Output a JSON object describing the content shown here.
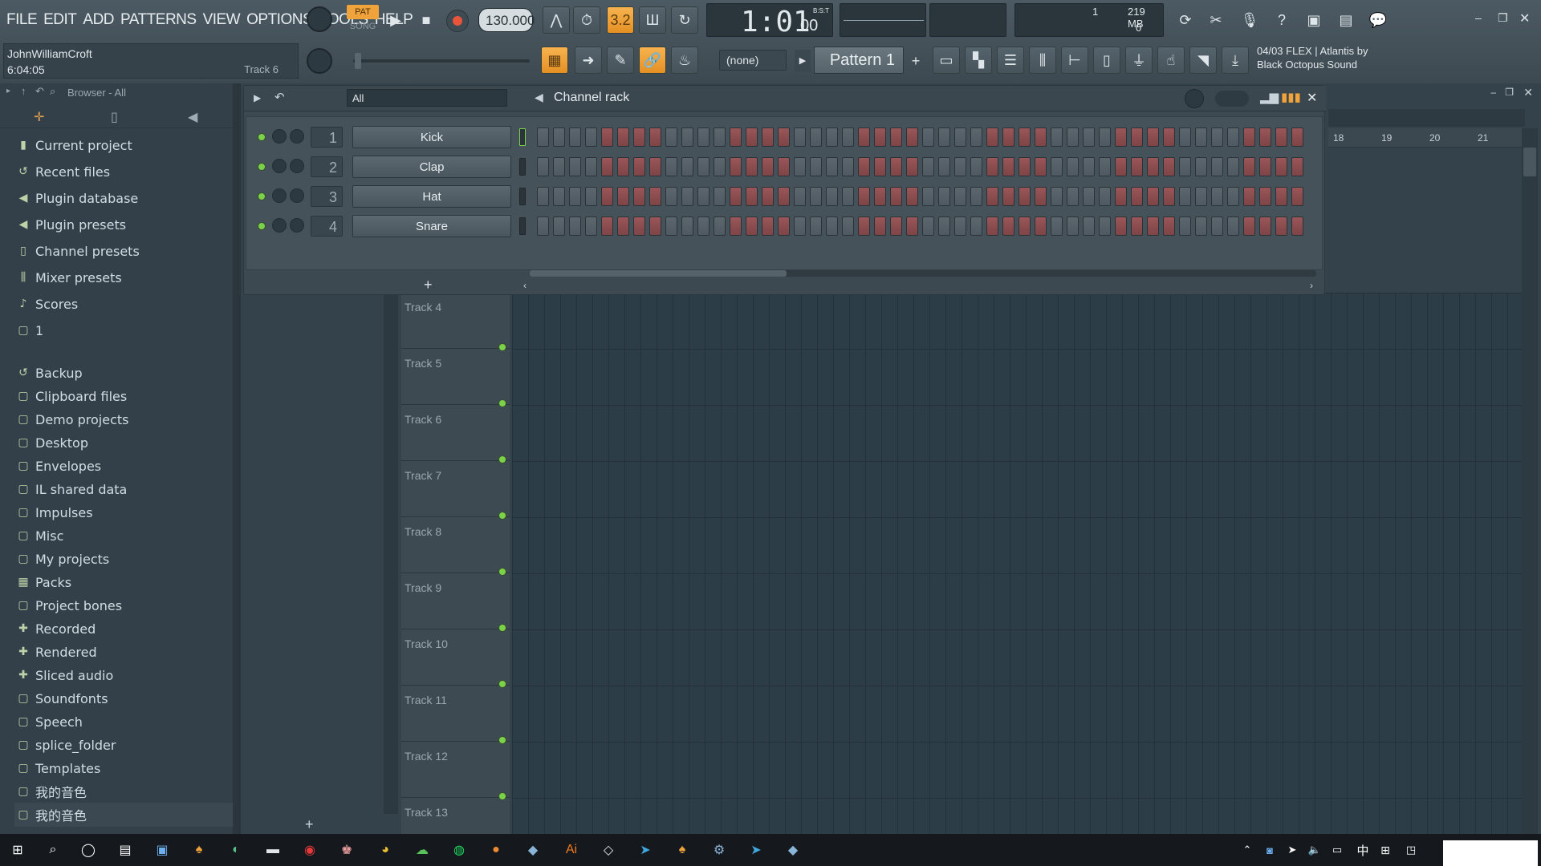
{
  "menu": [
    "FILE",
    "EDIT",
    "ADD",
    "PATTERNS",
    "VIEW",
    "OPTIONS",
    "TOOLS",
    "HELP"
  ],
  "transport": {
    "pat": "PAT",
    "song": "SONG",
    "tempo": "130.000",
    "time": "1:01",
    "time_small": "00",
    "bst": "B:S:T"
  },
  "monitor": {
    "cpu": "1",
    "mem": "219 MB",
    "poly": "0"
  },
  "hint": {
    "user": "JohnWilliamCroft",
    "time": "6:04:05",
    "track": "Track 6"
  },
  "pattern": {
    "none_label": "(none)",
    "name": "Pattern 1"
  },
  "news": {
    "line1": "04/03  FLEX | Atlantis by",
    "line2": "Black Octopus Sound"
  },
  "browser": {
    "header": "Browser - All",
    "items": [
      {
        "label": "Current project",
        "icon": "project-icon"
      },
      {
        "label": "Recent files",
        "icon": "recent-icon"
      },
      {
        "label": "Plugin database",
        "icon": "plugin-icon"
      },
      {
        "label": "Plugin presets",
        "icon": "preset-icon"
      },
      {
        "label": "Channel presets",
        "icon": "channel-icon"
      },
      {
        "label": "Mixer presets",
        "icon": "mixer-icon"
      },
      {
        "label": "Scores",
        "icon": "note-icon"
      },
      {
        "label": "1",
        "icon": "folder-icon"
      },
      {
        "label": "Backup",
        "icon": "recent-icon"
      },
      {
        "label": "Clipboard files",
        "icon": "folder-icon"
      },
      {
        "label": "Demo projects",
        "icon": "folder-icon"
      },
      {
        "label": "Desktop",
        "icon": "folder-icon"
      },
      {
        "label": "Envelopes",
        "icon": "folder-icon"
      },
      {
        "label": "IL shared data",
        "icon": "folder-icon"
      },
      {
        "label": "Impulses",
        "icon": "folder-icon"
      },
      {
        "label": "Misc",
        "icon": "folder-icon"
      },
      {
        "label": "My projects",
        "icon": "folder-icon"
      },
      {
        "label": "Packs",
        "icon": "pack-icon"
      },
      {
        "label": "Project bones",
        "icon": "folder-icon"
      },
      {
        "label": "Recorded",
        "icon": "plus-icon"
      },
      {
        "label": "Rendered",
        "icon": "plus-icon"
      },
      {
        "label": "Sliced audio",
        "icon": "plus-icon"
      },
      {
        "label": "Soundfonts",
        "icon": "folder-icon"
      },
      {
        "label": "Speech",
        "icon": "folder-icon"
      },
      {
        "label": "splice_folder",
        "icon": "folder-icon"
      },
      {
        "label": "Templates",
        "icon": "folder-icon"
      },
      {
        "label": "我的音色",
        "icon": "folder-icon"
      },
      {
        "label": "我的音色",
        "icon": "folder-icon"
      }
    ]
  },
  "channel_rack": {
    "title": "Channel rack",
    "filter": "All",
    "channels": [
      {
        "num": "1",
        "name": "Kick"
      },
      {
        "num": "2",
        "name": "Clap"
      },
      {
        "num": "3",
        "name": "Hat"
      },
      {
        "num": "4",
        "name": "Snare"
      }
    ]
  },
  "playlist": {
    "ruler": [
      "18",
      "19",
      "20",
      "21"
    ],
    "tracks": [
      "Track 4",
      "Track 5",
      "Track 6",
      "Track 7",
      "Track 8",
      "Track 9",
      "Track 10",
      "Track 11",
      "Track 12",
      "Track 13"
    ]
  },
  "colors": {
    "accent": "#f0a33a",
    "led": "#7bd14a",
    "step_red": "#8c4c4e"
  }
}
